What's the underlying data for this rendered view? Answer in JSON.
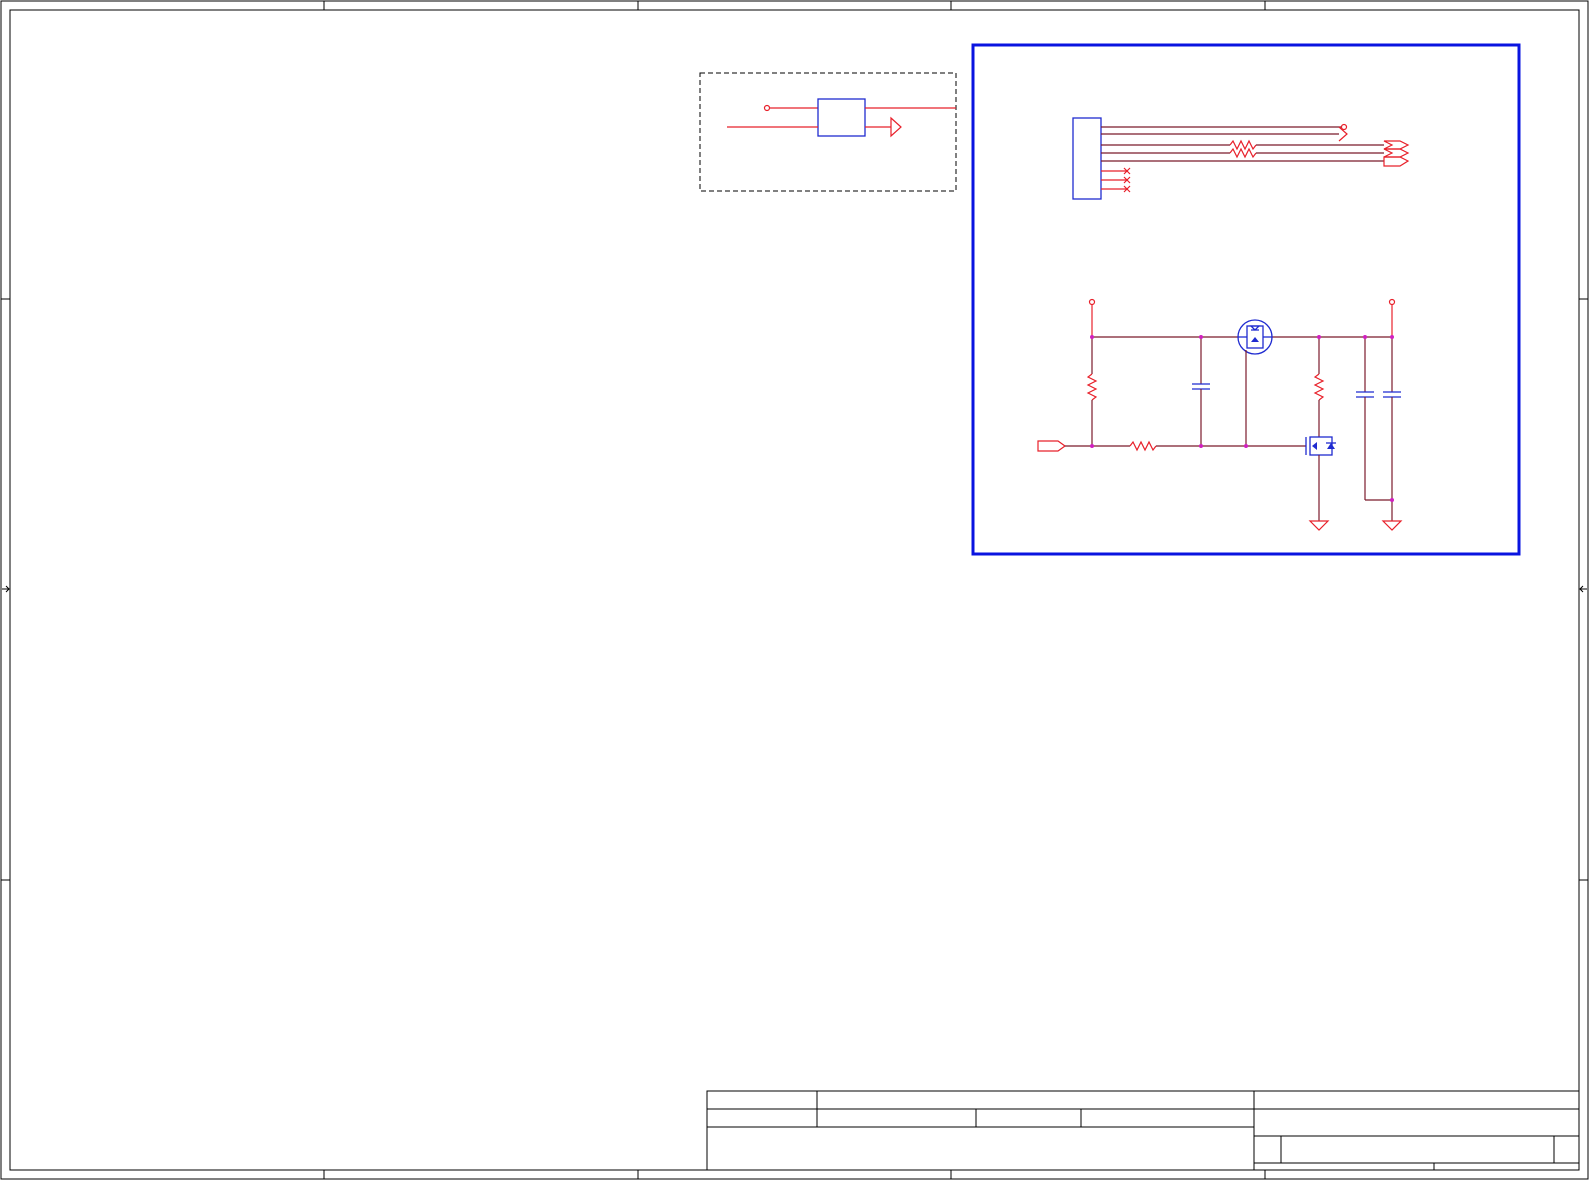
{
  "sheet": {
    "colors": {
      "wire": "#e8202a",
      "component": "#1f2bd0",
      "junction": "#d020c0",
      "frame": "#000000",
      "border_box": "#0a14e0"
    },
    "title_block": {
      "cells": []
    },
    "components": {
      "connector": "connector-block",
      "resistors": [
        "resistor",
        "resistor",
        "resistor",
        "resistor",
        "resistor"
      ],
      "capacitors": [
        "capacitor",
        "capacitor",
        "capacitor"
      ],
      "transistors": [
        "p-mosfet",
        "n-mosfet"
      ],
      "grounds": [
        "ground-symbol",
        "ground-symbol"
      ]
    }
  }
}
